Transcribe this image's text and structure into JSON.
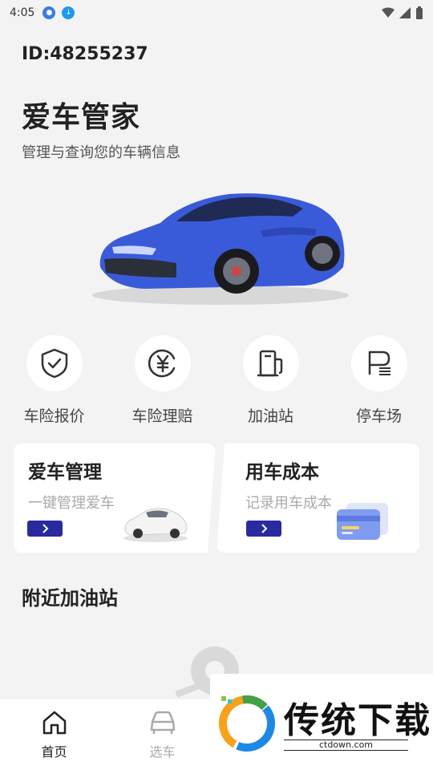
{
  "status": {
    "time": "4:05"
  },
  "header": {
    "user_id": "ID:48255237",
    "title": "爱车管家",
    "subtitle": "管理与查询您的车辆信息"
  },
  "quick_actions": [
    {
      "label": "车险报价",
      "icon": "shield-check-icon"
    },
    {
      "label": "车险理赔",
      "icon": "yen-coin-icon"
    },
    {
      "label": "加油站",
      "icon": "fuel-pump-icon"
    },
    {
      "label": "停车场",
      "icon": "parking-icon"
    }
  ],
  "cards": {
    "left": {
      "title": "爱车管理",
      "subtitle": "一键管理爱车"
    },
    "right": {
      "title": "用车成本",
      "subtitle": "记录用车成本"
    }
  },
  "nearby": {
    "title": "附近加油站"
  },
  "tabbar": [
    {
      "label": "首页",
      "icon": "home-icon",
      "active": true
    },
    {
      "label": "选车",
      "icon": "car-icon",
      "active": false
    }
  ],
  "watermark": {
    "text": "传统下载",
    "url": "ctdown.com"
  },
  "colors": {
    "accent": "#2a2aa0",
    "background": "#f3f3f3",
    "car_blue": "#3a5bd9"
  }
}
